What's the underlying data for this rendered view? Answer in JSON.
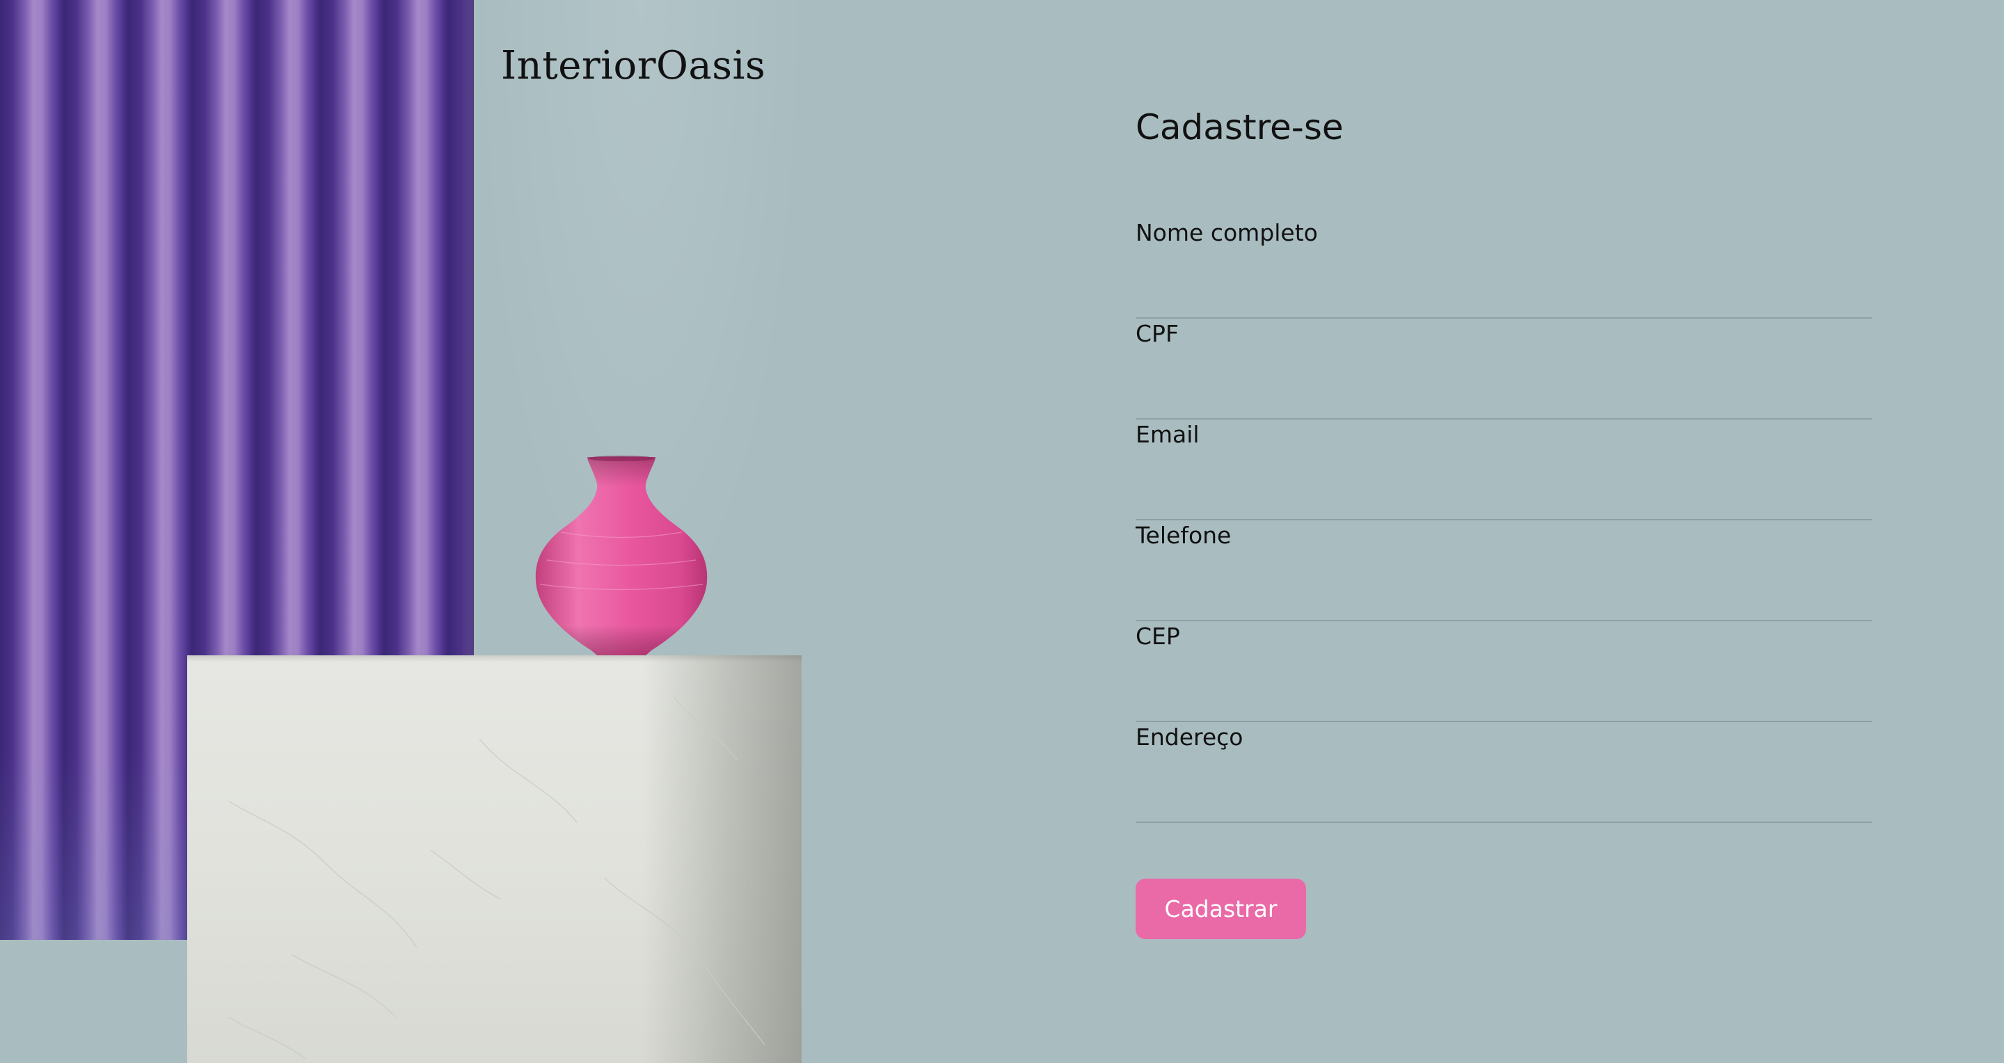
{
  "brand": {
    "logo_text": "InteriorOasis"
  },
  "hero": {
    "image_subject": "pink vase on white pedestal in front of purple curtain"
  },
  "form": {
    "title": "Cadastre-se",
    "fields": [
      {
        "label": "Nome completo",
        "value": ""
      },
      {
        "label": "CPF",
        "value": ""
      },
      {
        "label": "Email",
        "value": ""
      },
      {
        "label": "Telefone",
        "value": ""
      },
      {
        "label": "CEP",
        "value": ""
      },
      {
        "label": "Endereço",
        "value": ""
      }
    ],
    "submit_label": "Cadastrar"
  },
  "colors": {
    "background": "#a9bdc1",
    "accent_button": "#e96aa7",
    "curtain": "#5b3f98",
    "vase": "#e2589a",
    "pedestal": "#e1e2dc"
  }
}
